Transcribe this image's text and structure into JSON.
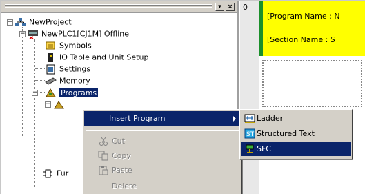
{
  "tree": {
    "project": "NewProject",
    "plc": "NewPLC1[CJ1M] Offline",
    "symbols": "Symbols",
    "io_table": "IO Table and Unit Setup",
    "settings": "Settings",
    "memory": "Memory",
    "programs": "Programs",
    "functions_partial": "Fur"
  },
  "editor": {
    "row_number": "0",
    "program_name": "[Program Name : N",
    "section_name": "[Section Name : S"
  },
  "context_menu": {
    "insert_program": "Insert Program",
    "cut": "Cut",
    "copy": "Copy",
    "paste": "Paste",
    "delete": "Delete"
  },
  "submenu": {
    "ladder": "Ladder",
    "structured_text": "Structured Text",
    "sfc": "SFC"
  },
  "colors": {
    "highlight": "#0a246a",
    "menu_bg": "#d4d0c8",
    "editor_yellow": "#ffff00",
    "editor_green": "#1a8f2a"
  }
}
